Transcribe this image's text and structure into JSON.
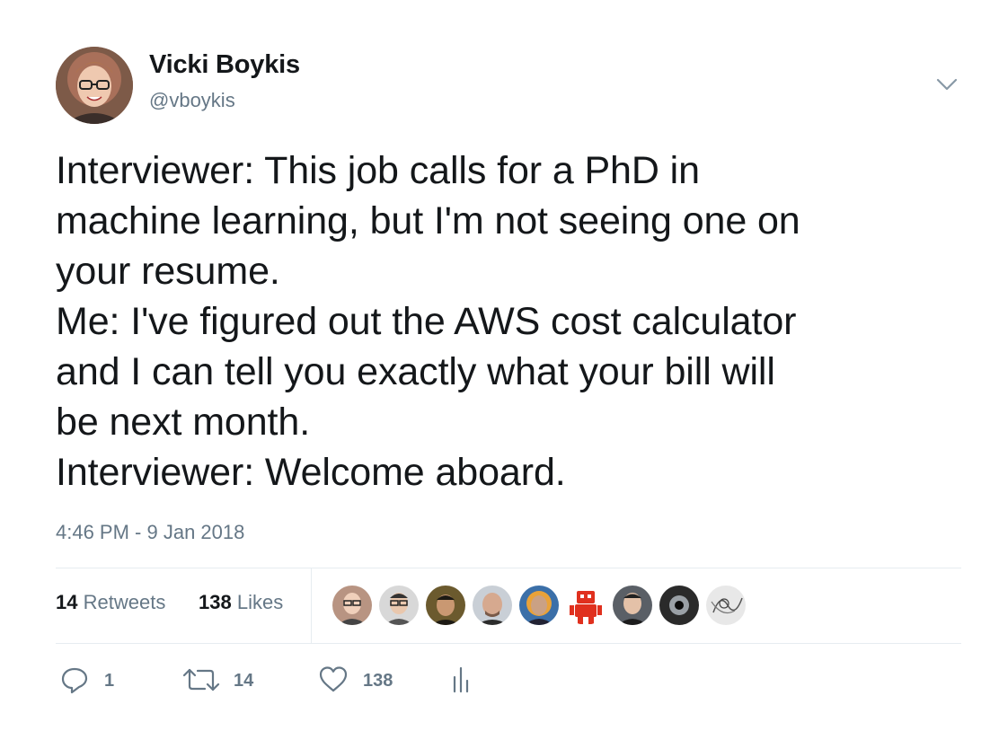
{
  "author": {
    "display_name": "Vicki Boykis",
    "handle": "@vboykis",
    "avatar_icon": "user-avatar-icon"
  },
  "tweet": {
    "lines": [
      "Interviewer: This job calls for a PhD in",
      "machine learning, but I'm not seeing one on",
      "your resume.",
      "Me: I've figured out the AWS cost calculator",
      "and I can tell you exactly what your bill will",
      "be next month.",
      "Interviewer: Welcome aboard."
    ],
    "timestamp": "4:46 PM - 9 Jan 2018"
  },
  "stats": {
    "retweets_count": "14",
    "retweets_label": "Retweets",
    "likes_count": "138",
    "likes_label": "Likes"
  },
  "likers": [
    {
      "icon": "liker-avatar-1-icon",
      "bg": "#b89482"
    },
    {
      "icon": "liker-avatar-2-icon",
      "bg": "#d8d8d8"
    },
    {
      "icon": "liker-avatar-3-icon",
      "bg": "#6b5a2e"
    },
    {
      "icon": "liker-avatar-4-icon",
      "bg": "#c9cfd6"
    },
    {
      "icon": "liker-avatar-5-icon",
      "bg": "#3b6fa8"
    },
    {
      "icon": "robot-avatar-icon",
      "bg": "#ffffff"
    },
    {
      "icon": "liker-avatar-7-icon",
      "bg": "#5a5f66"
    },
    {
      "icon": "dark-circle-avatar-icon",
      "bg": "#2a2a2a"
    },
    {
      "icon": "sketch-avatar-icon",
      "bg": "#e8e8e8"
    }
  ],
  "actions": {
    "reply_count": "1",
    "retweet_count": "14",
    "like_count": "138"
  },
  "colors": {
    "text_primary": "#14171a",
    "text_secondary": "#657786",
    "divider": "#e6ecf0",
    "robot_red": "#e0301e"
  }
}
